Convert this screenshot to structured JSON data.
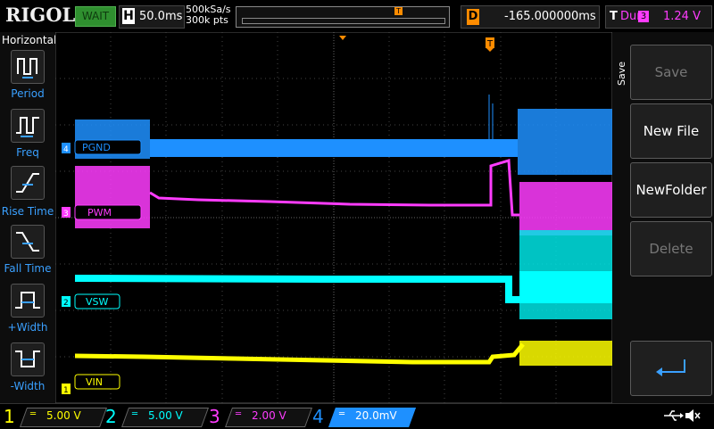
{
  "brand": "RIGOL",
  "trigger_status": "WAIT",
  "timebase": {
    "label": "H",
    "value": "50.0ms"
  },
  "sampling": {
    "rate": "500kSa/s",
    "depth": "300k pts"
  },
  "delay": {
    "label": "D",
    "value": "-165.000000ms"
  },
  "trigger": {
    "label": "T",
    "type": "Dur",
    "source": "3",
    "level": "1.24 V"
  },
  "left_menu": {
    "title": "Horizontal",
    "items": [
      {
        "label": "Period",
        "icon": "period-icon"
      },
      {
        "label": "Freq",
        "icon": "frequency-icon"
      },
      {
        "label": "Rise Time",
        "icon": "rise-time-icon"
      },
      {
        "label": "Fall Time",
        "icon": "fall-time-icon"
      },
      {
        "label": "+Width",
        "icon": "positive-width-icon"
      },
      {
        "label": "-Width",
        "icon": "negative-width-icon"
      }
    ]
  },
  "right_menu": {
    "title": "Save",
    "buttons": [
      {
        "label": "Save",
        "enabled": false
      },
      {
        "label": "New File",
        "enabled": true
      },
      {
        "label": "NewFolder",
        "enabled": true
      },
      {
        "label": "Delete",
        "enabled": false
      }
    ],
    "back_icon": "return-arrow-icon"
  },
  "waveform_labels": {
    "ch4": "PGND",
    "ch3": "PWM",
    "ch2": "VSW",
    "ch1": "VIN"
  },
  "channels": [
    {
      "num": "1",
      "scale": "5.00 V",
      "color": "#ffff00"
    },
    {
      "num": "2",
      "scale": "5.00 V",
      "color": "#00ffff"
    },
    {
      "num": "3",
      "scale": "2.00 V",
      "color": "#ff3cff"
    },
    {
      "num": "4",
      "scale": "20.0mV",
      "color": "#1e90ff"
    }
  ],
  "colors": {
    "ch1": "#ffff00",
    "ch2": "#00ffff",
    "ch3": "#ff3cff",
    "ch4": "#1e90ff",
    "trigger": "#ff8c00",
    "menu_blue": "#3aa0ff"
  }
}
